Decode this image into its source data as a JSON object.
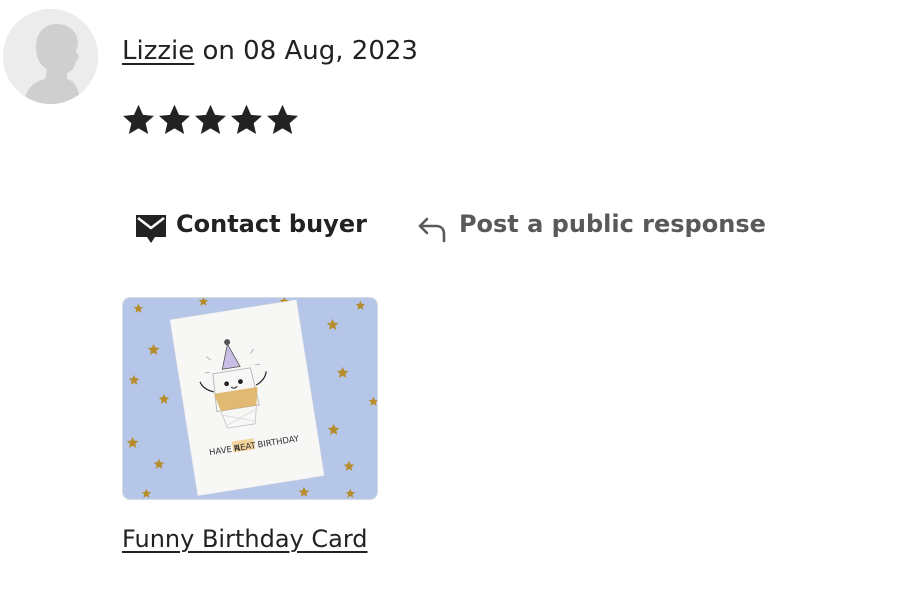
{
  "review": {
    "reviewer_name": "Lizzie",
    "date_text": " on 08 Aug, 2023",
    "rating": 5,
    "max_rating": 5
  },
  "actions": {
    "contact_label": "Contact buyer",
    "respond_label": "Post a public response"
  },
  "listing": {
    "card_text_prefix": "HAVE A",
    "card_text_highlight": "NEAT",
    "card_text_suffix": "BIRTHDAY",
    "title": "Funny Birthday Card"
  },
  "colors": {
    "text": "#222222",
    "muted": "#595959",
    "thumb_background": "#b5c6e8",
    "star_gold": "#b68d2c",
    "highlight": "#f2d49a"
  },
  "icons": {
    "avatar": "default-avatar-icon",
    "star": "star-icon",
    "contact": "mail-icon",
    "respond": "reply-icon"
  }
}
